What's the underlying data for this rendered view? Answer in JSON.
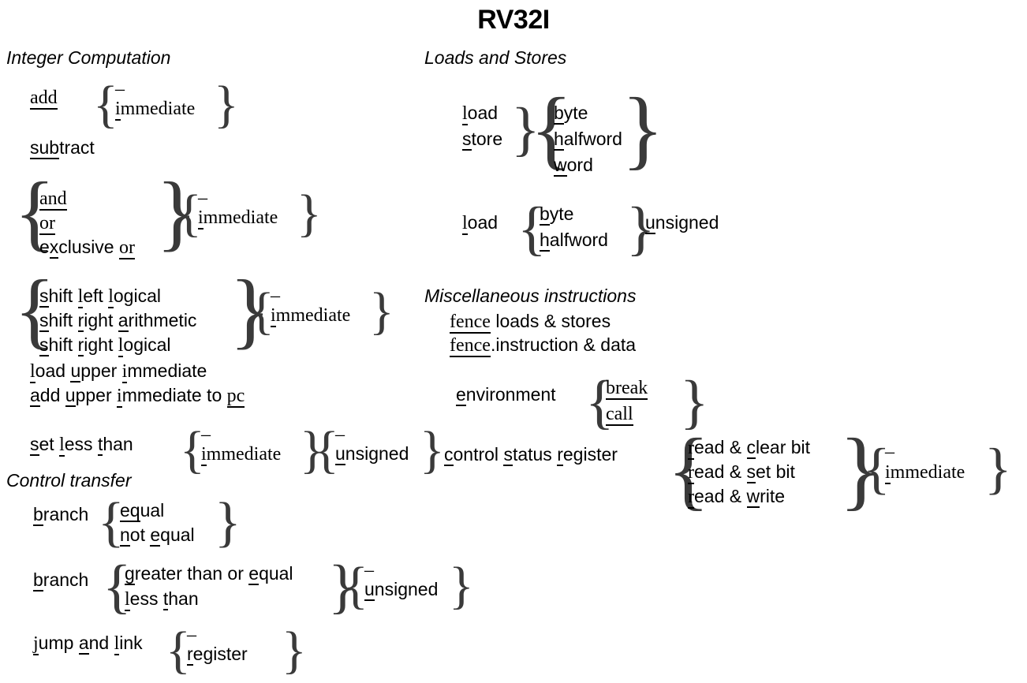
{
  "title": "RV32I",
  "sections": {
    "integer_computation": {
      "heading": "Integer Computation",
      "groups": {
        "add": {
          "base": "add",
          "options": [
            "–",
            "immediate"
          ]
        },
        "subtract": {
          "base": "subtract"
        },
        "logic": {
          "left_options": [
            "and",
            "or",
            "exclusive or"
          ],
          "right_options": [
            "–",
            "immediate"
          ]
        },
        "shift": {
          "left_options": [
            "shift left logical",
            "shift right arithmetic",
            "shift right logical"
          ],
          "right_options": [
            "–",
            "immediate"
          ]
        },
        "lui": "load upper immediate",
        "auipc": "add upper immediate to pc",
        "slt": {
          "base": "set less than",
          "group1": [
            "–",
            "immediate"
          ],
          "group2": [
            "–",
            "unsigned"
          ]
        }
      }
    },
    "control_transfer": {
      "heading": "Control transfer",
      "groups": {
        "branch_eq": {
          "base": "branch",
          "options": [
            "equal",
            "not equal"
          ]
        },
        "branch_cmp": {
          "base": "branch",
          "options": [
            "greater than or equal",
            "less than"
          ],
          "group2": [
            "–",
            "unsigned"
          ]
        },
        "jal": {
          "base": "jump and link",
          "options": [
            "–",
            "register"
          ]
        }
      }
    },
    "loads_and_stores": {
      "heading": "Loads and Stores",
      "groups": {
        "load_store": {
          "left_options": [
            "load",
            "store"
          ],
          "right_options": [
            "byte",
            "halfword",
            "word"
          ]
        },
        "load_unsigned": {
          "base": "load",
          "options": [
            "byte",
            "halfword"
          ],
          "suffix": "unsigned"
        }
      }
    },
    "miscellaneous": {
      "heading": "Miscellaneous instructions",
      "items": {
        "fence_ls": {
          "mnemonic": "fence",
          "rest": " loads & stores"
        },
        "fence_i": {
          "mnemonic": "fence",
          "rest": ".instruction & data"
        },
        "environment": {
          "base": "environment",
          "options": [
            "break",
            "call"
          ]
        },
        "csr": {
          "base": "control status register",
          "options": [
            "read & clear bit",
            "read & set bit",
            "read & write"
          ],
          "group2": [
            "–",
            "immediate"
          ]
        }
      }
    }
  },
  "colors": {
    "ink": "#000000",
    "brace": "#3a3a3a"
  }
}
